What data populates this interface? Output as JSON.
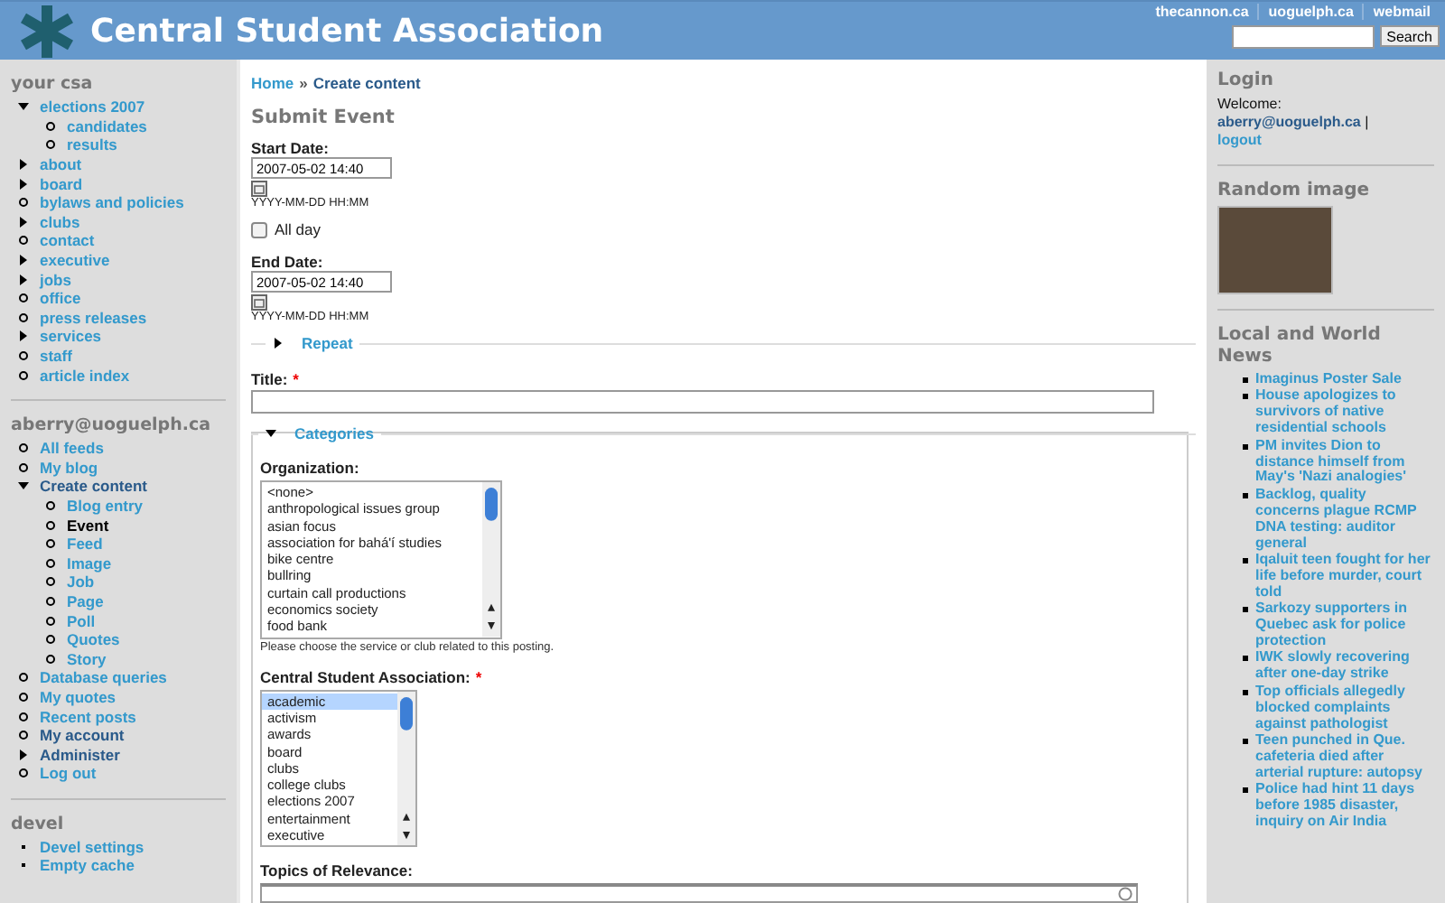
{
  "header": {
    "title": "Central Student Association",
    "links": [
      "thecannon.ca",
      "uoguelph.ca",
      "webmail"
    ],
    "search_button": "Search"
  },
  "left_blocks": [
    {
      "title": "your csa",
      "items": [
        {
          "label": "elections 2007",
          "kind": "expanded",
          "selected": false,
          "children": [
            {
              "label": "candidates",
              "kind": "leaf",
              "selected": false
            },
            {
              "label": "results",
              "kind": "leaf",
              "selected": false
            }
          ]
        },
        {
          "label": "about",
          "kind": "collapsed",
          "selected": false
        },
        {
          "label": "board",
          "kind": "collapsed",
          "selected": false
        },
        {
          "label": "bylaws and policies",
          "kind": "leaf",
          "selected": false
        },
        {
          "label": "clubs",
          "kind": "collapsed",
          "selected": false
        },
        {
          "label": "contact",
          "kind": "leaf",
          "selected": false
        },
        {
          "label": "executive",
          "kind": "collapsed",
          "selected": false
        },
        {
          "label": "jobs",
          "kind": "collapsed",
          "selected": false
        },
        {
          "label": "office",
          "kind": "leaf",
          "selected": false
        },
        {
          "label": "press releases",
          "kind": "leaf",
          "selected": false
        },
        {
          "label": "services",
          "kind": "collapsed",
          "selected": false
        },
        {
          "label": "staff",
          "kind": "leaf",
          "selected": false
        },
        {
          "label": "article index",
          "kind": "leaf",
          "selected": false
        }
      ]
    },
    {
      "title": "aberry@uoguelph.ca",
      "items": [
        {
          "label": "All feeds",
          "kind": "leaf",
          "selected": false
        },
        {
          "label": "My blog",
          "kind": "leaf",
          "selected": false
        },
        {
          "label": "Create content",
          "kind": "expanded",
          "selected": false,
          "trail": true,
          "children": [
            {
              "label": "Blog entry",
              "kind": "leaf",
              "selected": false
            },
            {
              "label": "Event",
              "kind": "leaf",
              "selected": true
            },
            {
              "label": "Feed",
              "kind": "leaf",
              "selected": false
            },
            {
              "label": "Image",
              "kind": "leaf",
              "selected": false
            },
            {
              "label": "Job",
              "kind": "leaf",
              "selected": false
            },
            {
              "label": "Page",
              "kind": "leaf",
              "selected": false
            },
            {
              "label": "Poll",
              "kind": "leaf",
              "selected": false
            },
            {
              "label": "Quotes",
              "kind": "leaf",
              "selected": false
            },
            {
              "label": "Story",
              "kind": "leaf",
              "selected": false
            }
          ]
        },
        {
          "label": "Database queries",
          "kind": "leaf",
          "selected": false
        },
        {
          "label": "My quotes",
          "kind": "leaf",
          "selected": false
        },
        {
          "label": "Recent posts",
          "kind": "leaf",
          "selected": false
        },
        {
          "label": "My account",
          "kind": "leaf",
          "selected": false,
          "trail": true
        },
        {
          "label": "Administer",
          "kind": "collapsed",
          "selected": false,
          "trail": true
        },
        {
          "label": "Log out",
          "kind": "leaf",
          "selected": false
        }
      ]
    },
    {
      "title": "devel",
      "items": [
        {
          "label": "Devel settings",
          "kind": "bullet",
          "selected": false
        },
        {
          "label": "Empty cache",
          "kind": "bullet",
          "selected": false
        }
      ]
    }
  ],
  "breadcrumb": [
    "Home",
    "Create content"
  ],
  "breadcrumb_separator": "»",
  "heading": "Submit Event",
  "start_date": {
    "label": "Start Date:",
    "value": "2007-05-02 14:40",
    "hint": "YYYY-MM-DD HH:MM"
  },
  "all_day": {
    "label": "All day",
    "checked": false
  },
  "end_date": {
    "label": "End Date:",
    "value": "2007-05-02 14:40",
    "hint": "YYYY-MM-DD HH:MM"
  },
  "repeat": {
    "legend": "Repeat",
    "expanded": false
  },
  "title_field": {
    "label": "Title:",
    "required_mark": "*"
  },
  "categories": {
    "legend": "Categories",
    "expanded": true
  },
  "organization": {
    "label": "Organization:",
    "options": [
      {
        "label": "<none>",
        "selected": false
      },
      {
        "label": "anthropological issues group",
        "selected": false
      },
      {
        "label": "asian focus",
        "selected": false
      },
      {
        "label": "association for bahá'í studies",
        "selected": false
      },
      {
        "label": "bike centre",
        "selected": false
      },
      {
        "label": "bullring",
        "selected": false
      },
      {
        "label": "curtain call productions",
        "selected": false
      },
      {
        "label": "economics society",
        "selected": false
      },
      {
        "label": "food bank",
        "selected": false
      }
    ],
    "help": "Please choose the service or club related to this posting."
  },
  "csa": {
    "label": "Central Student Association:",
    "required_mark": "*",
    "options": [
      {
        "label": "academic",
        "selected": true
      },
      {
        "label": "activism",
        "selected": false
      },
      {
        "label": "awards",
        "selected": false
      },
      {
        "label": "board",
        "selected": false
      },
      {
        "label": "clubs",
        "selected": false
      },
      {
        "label": "college clubs",
        "selected": false
      },
      {
        "label": "elections 2007",
        "selected": false
      },
      {
        "label": "entertainment",
        "selected": false
      },
      {
        "label": "executive",
        "selected": false
      }
    ]
  },
  "topics": {
    "label": "Topics of Relevance:"
  },
  "login": {
    "title": "Login",
    "welcome": "Welcome:",
    "user": "aberry@uoguelph.ca",
    "separator": "|",
    "logout": "logout"
  },
  "random_image": {
    "title": "Random image"
  },
  "news": {
    "title": "Local and World News",
    "items": [
      "Imaginus Poster Sale",
      "House apologizes to survivors of native residential schools",
      "PM invites Dion to distance himself from May's 'Nazi analogies'",
      "Backlog, quality concerns plague RCMP DNA testing: auditor general",
      "Iqaluit teen fought for her life before murder, court told",
      "Sarkozy supporters in Quebec ask for police protection",
      "IWK slowly recovering after one-day strike",
      "Top officials allegedly blocked complaints against pathologist",
      "Teen punched in Que. cafeteria died after arterial rupture: autopsy",
      "Police had hint 11 days before 1985 disaster, inquiry on Air India"
    ]
  }
}
